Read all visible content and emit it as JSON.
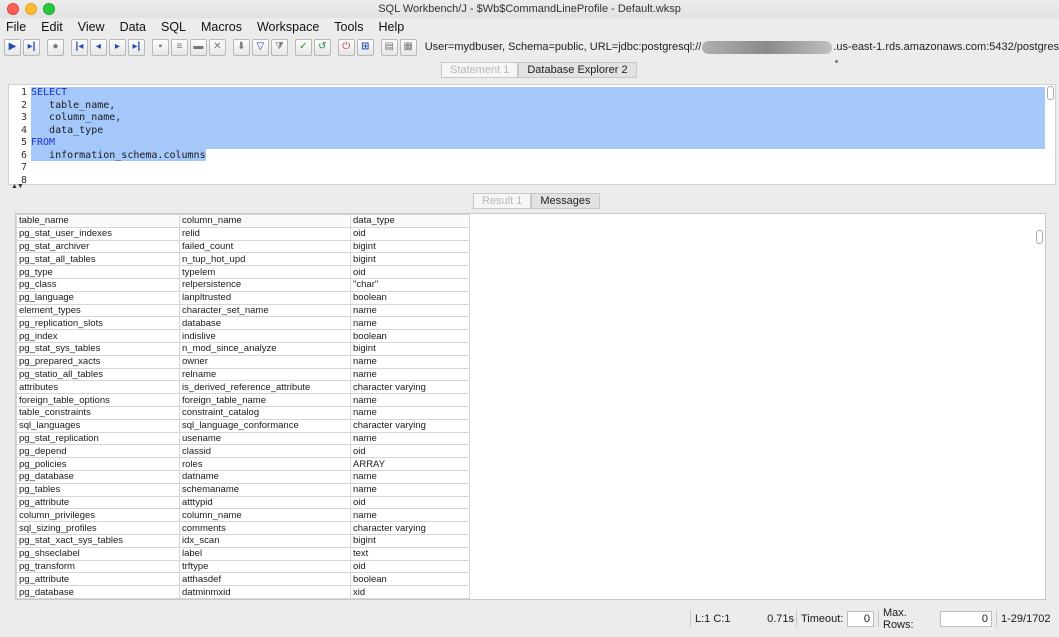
{
  "window": {
    "title": "SQL Workbench/J - $Wb$CommandLineProfile - Default.wksp"
  },
  "menu": [
    "File",
    "Edit",
    "View",
    "Data",
    "SQL",
    "Macros",
    "Workspace",
    "Tools",
    "Help"
  ],
  "toolbar": {
    "connection_prefix": "User=mydbuser, Schema=public, URL=jdbc:postgresql://",
    "connection_suffix": ".us-east-1.rds.amazonaws.com:5432/postgres"
  },
  "editor_tabs": [
    "Statement 1",
    "Database Explorer 2"
  ],
  "editor": {
    "lines": [
      {
        "n": "1",
        "text": "SELECT",
        "kw": true
      },
      {
        "n": "2",
        "text": "   table_name,",
        "kw": false
      },
      {
        "n": "3",
        "text": "   column_name,",
        "kw": false
      },
      {
        "n": "4",
        "text": "   data_type",
        "kw": false
      },
      {
        "n": "5",
        "text": "FROM",
        "kw": true
      },
      {
        "n": "6",
        "text": "   information_schema.columns",
        "kw": false
      },
      {
        "n": "7",
        "text": "",
        "kw": false
      },
      {
        "n": "8",
        "text": "",
        "kw": false
      }
    ]
  },
  "result_tabs": [
    "Result 1",
    "Messages"
  ],
  "grid": {
    "headers": [
      "table_name",
      "column_name",
      "data_type"
    ],
    "rows": [
      [
        "pg_stat_user_indexes",
        "relid",
        "oid"
      ],
      [
        "pg_stat_archiver",
        "failed_count",
        "bigint"
      ],
      [
        "pg_stat_all_tables",
        "n_tup_hot_upd",
        "bigint"
      ],
      [
        "pg_type",
        "typelem",
        "oid"
      ],
      [
        "pg_class",
        "relpersistence",
        "\"char\""
      ],
      [
        "pg_language",
        "lanpltrusted",
        "boolean"
      ],
      [
        "element_types",
        "character_set_name",
        "name"
      ],
      [
        "pg_replication_slots",
        "database",
        "name"
      ],
      [
        "pg_index",
        "indislive",
        "boolean"
      ],
      [
        "pg_stat_sys_tables",
        "n_mod_since_analyze",
        "bigint"
      ],
      [
        "pg_prepared_xacts",
        "owner",
        "name"
      ],
      [
        "pg_statio_all_tables",
        "relname",
        "name"
      ],
      [
        "attributes",
        "is_derived_reference_attribute",
        "character varying"
      ],
      [
        "foreign_table_options",
        "foreign_table_name",
        "name"
      ],
      [
        "table_constraints",
        "constraint_catalog",
        "name"
      ],
      [
        "sql_languages",
        "sql_language_conformance",
        "character varying"
      ],
      [
        "pg_stat_replication",
        "usename",
        "name"
      ],
      [
        "pg_depend",
        "classid",
        "oid"
      ],
      [
        "pg_policies",
        "roles",
        "ARRAY"
      ],
      [
        "pg_database",
        "datname",
        "name"
      ],
      [
        "pg_tables",
        "schemaname",
        "name"
      ],
      [
        "pg_attribute",
        "atttypid",
        "oid"
      ],
      [
        "column_privileges",
        "column_name",
        "name"
      ],
      [
        "sql_sizing_profiles",
        "comments",
        "character varying"
      ],
      [
        "pg_stat_xact_sys_tables",
        "idx_scan",
        "bigint"
      ],
      [
        "pg_shseclabel",
        "label",
        "text"
      ],
      [
        "pg_transform",
        "trftype",
        "oid"
      ],
      [
        "pg_attribute",
        "atthasdef",
        "boolean"
      ],
      [
        "pg_database",
        "datminmxid",
        "xid"
      ]
    ]
  },
  "status": {
    "cursor": "L:1 C:1",
    "elapsed": "0.71s",
    "timeout_label": "Timeout:",
    "timeout_value": "0",
    "maxrows_label": "Max. Rows:",
    "maxrows_value": "0",
    "row_range": "1-29/1702"
  }
}
